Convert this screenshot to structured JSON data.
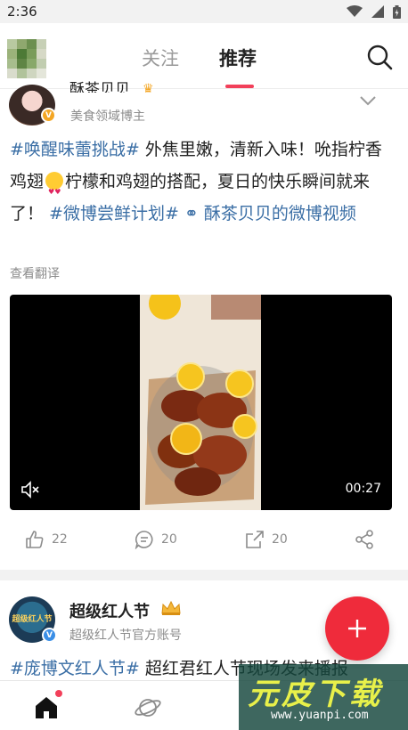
{
  "status_bar": {
    "time": "2:36",
    "icons": [
      "wifi-icon",
      "signal-icon",
      "battery-icon"
    ]
  },
  "header": {
    "tabs": [
      {
        "label": "关注",
        "active": false
      },
      {
        "label": "推荐",
        "active": true
      }
    ],
    "accent": "#f2405a"
  },
  "post1": {
    "author": "酥茶贝贝",
    "subtitle": "美食领域博主",
    "text_parts": {
      "tag1": "#唤醒味蕾挑战#",
      "body1": " 外焦里嫩，清新入味！吮指柠香鸡翅",
      "body2": "柠檬和鸡翅的搭配，夏日的快乐瞬间就来了！ ",
      "tag2": "#微博尝鲜计划#",
      "link": " 酥茶贝贝的微博视频"
    },
    "translate": "查看翻译",
    "video": {
      "duration": "00:27",
      "muted": true
    },
    "actions": {
      "likes": "22",
      "comments": "20",
      "reposts": "20"
    }
  },
  "post2": {
    "author": "超级红人节",
    "subtitle": "超级红人节官方账号",
    "avatar_text": "超级红人节",
    "text_parts": {
      "tag": "#庞博文红人节#",
      "body": " 超红君红人节现场发来播报"
    }
  },
  "watermark": {
    "title": "元皮下载",
    "url": "www.yuanpi.com"
  },
  "colors": {
    "link": "#3a6ea5",
    "fab": "#ef2b3b",
    "verified_gold": "#f4a623",
    "verified_blue": "#3a8ee6"
  }
}
